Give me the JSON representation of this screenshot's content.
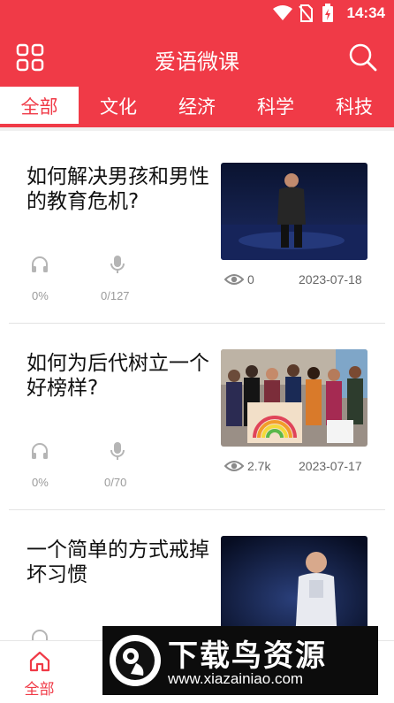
{
  "status_bar": {
    "time": "14:34"
  },
  "app_bar": {
    "title": "爱语微课"
  },
  "tabs": [
    {
      "label": "全部",
      "active": true
    },
    {
      "label": "文化",
      "active": false
    },
    {
      "label": "经济",
      "active": false
    },
    {
      "label": "科学",
      "active": false
    },
    {
      "label": "科技",
      "active": false
    }
  ],
  "courses": [
    {
      "title": "如何解决男孩和男性的教育危机?",
      "listen_progress": "0%",
      "record_progress": "0/127",
      "views": "0",
      "date": "2023-07-18"
    },
    {
      "title": "如何为后代树立一个好榜样?",
      "listen_progress": "0%",
      "record_progress": "0/70",
      "views": "2.7k",
      "date": "2023-07-17"
    },
    {
      "title": "一个简单的方式戒掉坏习惯",
      "listen_progress": "",
      "record_progress": "",
      "views": "",
      "date": ""
    }
  ],
  "bottom_nav": [
    {
      "label": "全部",
      "icon": "home-icon",
      "active": true
    },
    {
      "label": "",
      "icon": "",
      "active": false
    },
    {
      "label": "",
      "icon": "",
      "active": false
    },
    {
      "label": "",
      "icon": "",
      "active": false
    },
    {
      "label": "",
      "icon": "",
      "active": false
    }
  ],
  "watermark": {
    "title": "下载鸟资源",
    "url": "www.xiazainiao.com"
  },
  "colors": {
    "accent": "#f03a47",
    "background": "#ffffff",
    "muted_text": "#9a9a9a"
  }
}
